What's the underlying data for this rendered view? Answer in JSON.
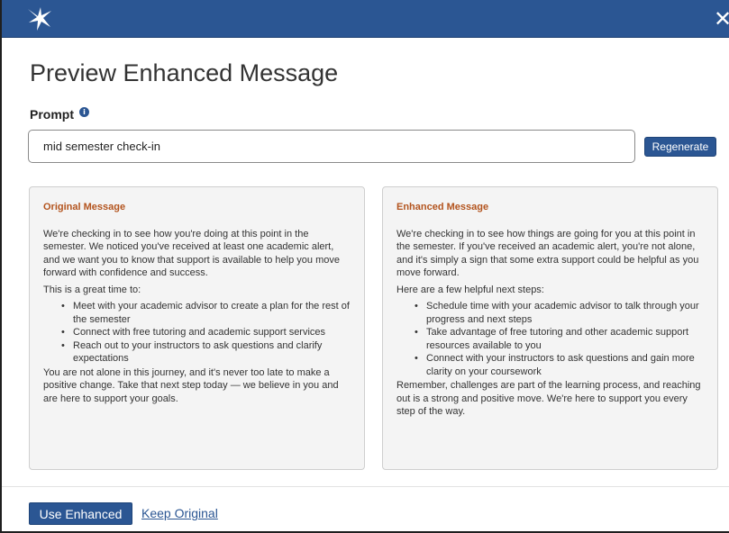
{
  "header": {
    "logo_icon": "star-burst-logo-icon",
    "close_glyph": "✕",
    "background_color": "#2b5693"
  },
  "dialog": {
    "title": "Preview Enhanced Message"
  },
  "prompt": {
    "label": "Prompt",
    "info_glyph": "i",
    "value": "mid semester check-in",
    "regenerate_label": "Regenerate"
  },
  "original": {
    "title": "Original Message",
    "intro": "We're checking in to see how you're doing at this point in the semester. We noticed you've received at least one academic alert, and we want you to know that support is available to help you move forward with confidence and success.",
    "lead": "This is a great time to:",
    "items": [
      "Meet with your academic advisor to create a plan for the rest of the semester",
      "Connect with free tutoring and academic support services",
      "Reach out to your instructors to ask questions and clarify expectations"
    ],
    "closing": "You are not alone in this journey, and it's never too late to make a positive change. Take that next step today — we believe in you and are here to support your goals."
  },
  "enhanced": {
    "title": "Enhanced Message",
    "intro": "We're checking in to see how things are going for you at this point in the semester. If you've received an academic alert, you're not alone, and it's simply a sign that some extra support could be helpful as you move forward.",
    "lead": "Here are a few helpful next steps:",
    "items": [
      "Schedule time with your academic advisor to talk through your progress and next steps",
      "Take advantage of free tutoring and other academic support resources available to you",
      "Connect with your instructors to ask questions and gain more clarity on your coursework"
    ],
    "closing": "Remember, challenges are part of the learning process, and reaching out is a strong and positive move. We're here to support you every step of the way."
  },
  "footer": {
    "use_enhanced_label": "Use Enhanced",
    "keep_original_label": "Keep Original"
  },
  "colors": {
    "accent": "#2b5693",
    "panel_title": "#b3541e",
    "panel_background": "#f4f4f4"
  }
}
